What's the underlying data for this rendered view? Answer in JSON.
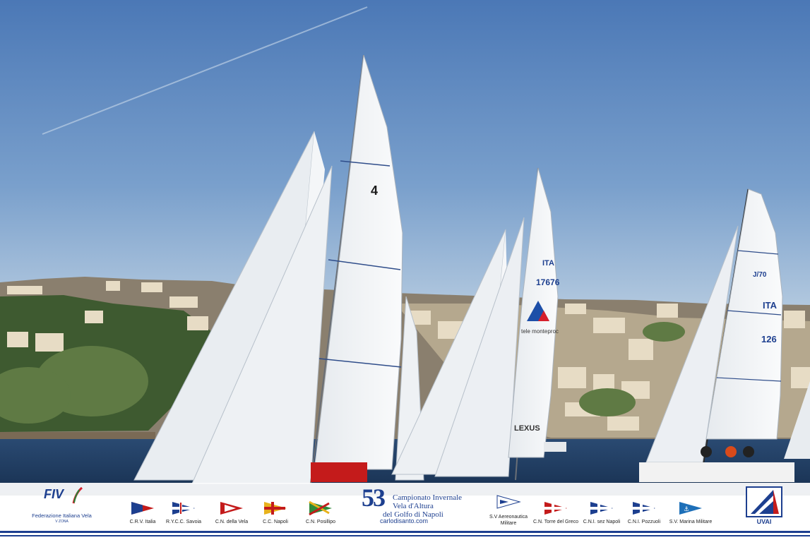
{
  "footer": {
    "fiv": {
      "mark": "FIV",
      "name": "Federazione Italiana Vela",
      "sub": "V ZONA"
    },
    "event": {
      "number": "53",
      "line1": "Campionato Invernale",
      "line2": "Vela d'Altura",
      "line3": "del Golfo di Napoli",
      "website": "carlodisanto.com"
    },
    "clubs_left": [
      {
        "name": "C.R.V. Italia"
      },
      {
        "name": "R.Y.C.C. Savoia"
      },
      {
        "name": "C.N. della Vela"
      },
      {
        "name": "C.C. Napoli"
      },
      {
        "name": "C.N. Posillipo"
      }
    ],
    "clubs_right": [
      {
        "name": "S.V Aereonautica Militare"
      },
      {
        "name": "C.N. Torre del Greco"
      },
      {
        "name": "C.N.I. sez Napoli"
      },
      {
        "name": "C.N.I. Pozzuoli"
      },
      {
        "name": "S.V. Marina Militare"
      }
    ],
    "uvai": {
      "label": "UVAI"
    }
  },
  "sail_text": {
    "boat_4": "4",
    "boat_17676_country": "ITA",
    "boat_17676_number": "17676",
    "boat_17676_sponsor": "tele monteproc",
    "boat_17676_lexus": "LEXUS",
    "boat_126_class": "J/70",
    "boat_126_country": "ITA",
    "boat_126_number": "126"
  },
  "colors": {
    "navy": "#1d3f8f",
    "sky_top": "#4c79b5",
    "sky_bottom": "#a8c2dc",
    "sea": "#1f3e63"
  }
}
